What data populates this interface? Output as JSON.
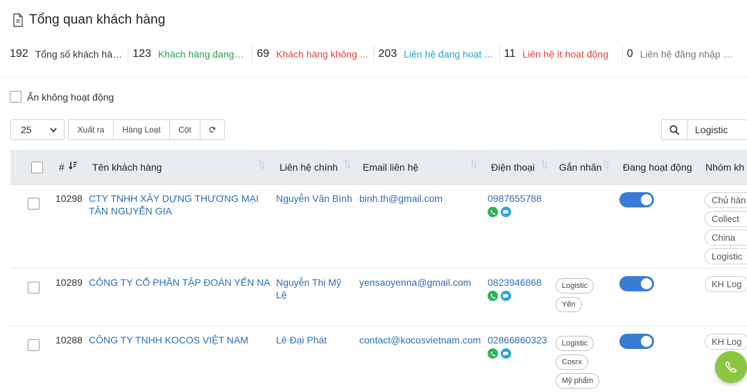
{
  "page": {
    "title": "Tổng quan khách hàng"
  },
  "stats": [
    {
      "value": "192",
      "label": "Tổng số khách hàng",
      "color": "#333333"
    },
    {
      "value": "123",
      "label": "Khách hàng đang h...",
      "color": "#27a745"
    },
    {
      "value": "69",
      "label": "Khách hàng không ...",
      "color": "#e0423c"
    },
    {
      "value": "203",
      "label": "Liên hệ đang hoạt ...",
      "color": "#21a2d1"
    },
    {
      "value": "11",
      "label": "Liên hệ ít hoạt động",
      "color": "#e0423c"
    },
    {
      "value": "0",
      "label": "Liên hệ đăng nhập hô...",
      "color": "#777777"
    }
  ],
  "filters": {
    "hide_inactive_label": "Ẩn không hoạt động"
  },
  "toolbar": {
    "page_size": "25",
    "export_label": "Xuất ra",
    "bulk_label": "Hàng Loạt",
    "columns_label": "Cột",
    "reload_icon": "reload-icon"
  },
  "search": {
    "value": "Logistic",
    "icon": "search-icon"
  },
  "table": {
    "columns": {
      "id": "#",
      "name": "Tên khách hàng",
      "contact": "Liên hệ chính",
      "email": "Email liên hệ",
      "phone": "Điện thoại",
      "tags": "Gắn nhãn",
      "active": "Đang hoạt động",
      "group": "Nhóm kh"
    },
    "rows": [
      {
        "id": "10298",
        "name": "CTY TNHH XÂY DỰNG THƯƠNG MẠI TÂN NGUYỄN GIA",
        "contact": "Nguyễn Văn Bình",
        "email": "binh.th@gmail.com",
        "phone": "0987655788",
        "tags": [],
        "active": true,
        "groups": [
          "Chủ hàn",
          "Collect",
          "China",
          "Logistic"
        ]
      },
      {
        "id": "10289",
        "name": "CÔNG TY CỔ PHẦN TẬP ĐOÀN YẾN NA",
        "contact": "Nguyễn Thị Mỹ Lệ",
        "email": "yensaoyenna@gmail.com",
        "phone": "0823946868",
        "tags": [
          "Logistic",
          "Yến"
        ],
        "active": true,
        "groups": [
          "KH Log"
        ]
      },
      {
        "id": "10288",
        "name": "CÔNG TY TNHH KOCOS VIỆT NAM",
        "contact": "Lê Đại Phát",
        "email": "contact@kocosvietnam.com",
        "phone": "02866860323",
        "tags": [
          "Logistic",
          "Cosrx",
          "Mỹ phẩm"
        ],
        "active": true,
        "groups": [
          "KH Log"
        ]
      }
    ]
  },
  "fab": {
    "icon": "phone-icon",
    "color": "#8bc63f"
  }
}
